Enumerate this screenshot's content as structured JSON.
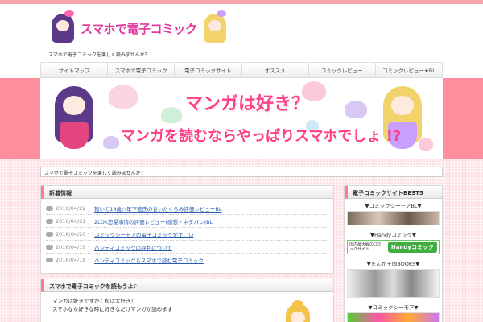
{
  "site": {
    "logo_text": "スマホで電子コミック",
    "tagline": "スマホで電子コミックを楽しく読みませんか？"
  },
  "nav": {
    "items": [
      {
        "label": "サイトマップ"
      },
      {
        "label": "スマホで電子コミック"
      },
      {
        "label": "電子コミックサイト"
      },
      {
        "label": "オススメ"
      },
      {
        "label": "コミックレビュー"
      },
      {
        "label": "コミックレビュー★BL"
      }
    ]
  },
  "banner": {
    "line1": "マンガは好き？",
    "line2": "マンガを読むならやっぱりスマホでしょ !?"
  },
  "breadcrumb": {
    "text": "スマホで電子コミックを楽しく読みませんか？"
  },
  "news": {
    "title": "新着情報",
    "items": [
      {
        "date": "2016/04/22",
        "sep": "：",
        "text": "抱いて18歳☆年下彼氏の甘いたくらみ評価レビューBL"
      },
      {
        "date": "2016/04/21",
        "sep": "：",
        "text": "2LDK恋愛事情の評価レビュー(感想・ネタバレ)BL"
      },
      {
        "date": "2016/04/20",
        "sep": "：",
        "text": "コミックシーモアの電子コミックがすごい"
      },
      {
        "date": "2016/04/19",
        "sep": "：",
        "text": "ハンディコミックの評判について"
      },
      {
        "date": "2016/04/18",
        "sep": "：",
        "text": "ハンディコミック＆スマホで読む電子コミック"
      }
    ]
  },
  "intro": {
    "title": "スマホで電子コミックを読もうよ♪",
    "lines": [
      "マンガは好きですか？私は大好き！",
      "スマホなら好きな時に好きなだけマンガが読めます"
    ]
  },
  "sidebar": {
    "title": "電子コミックサイトBEST5",
    "sections": [
      {
        "label": "▼コミックシーモアBL▼"
      },
      {
        "label": "▼Handyコミック▼",
        "banner_text": "国内最大級のコミックサイト",
        "banner_brand": "Handyコミック"
      },
      {
        "label": "▼まんが王国BOOKS▼"
      },
      {
        "label": "▼コミックシーモア▼"
      }
    ]
  },
  "colors": {
    "accent": "#ff8f9c",
    "logo_pink": "#e23aa0",
    "banner_text": "#ff3e86",
    "link_blue": "#2a5db0",
    "handy_green": "#3fae3f"
  }
}
